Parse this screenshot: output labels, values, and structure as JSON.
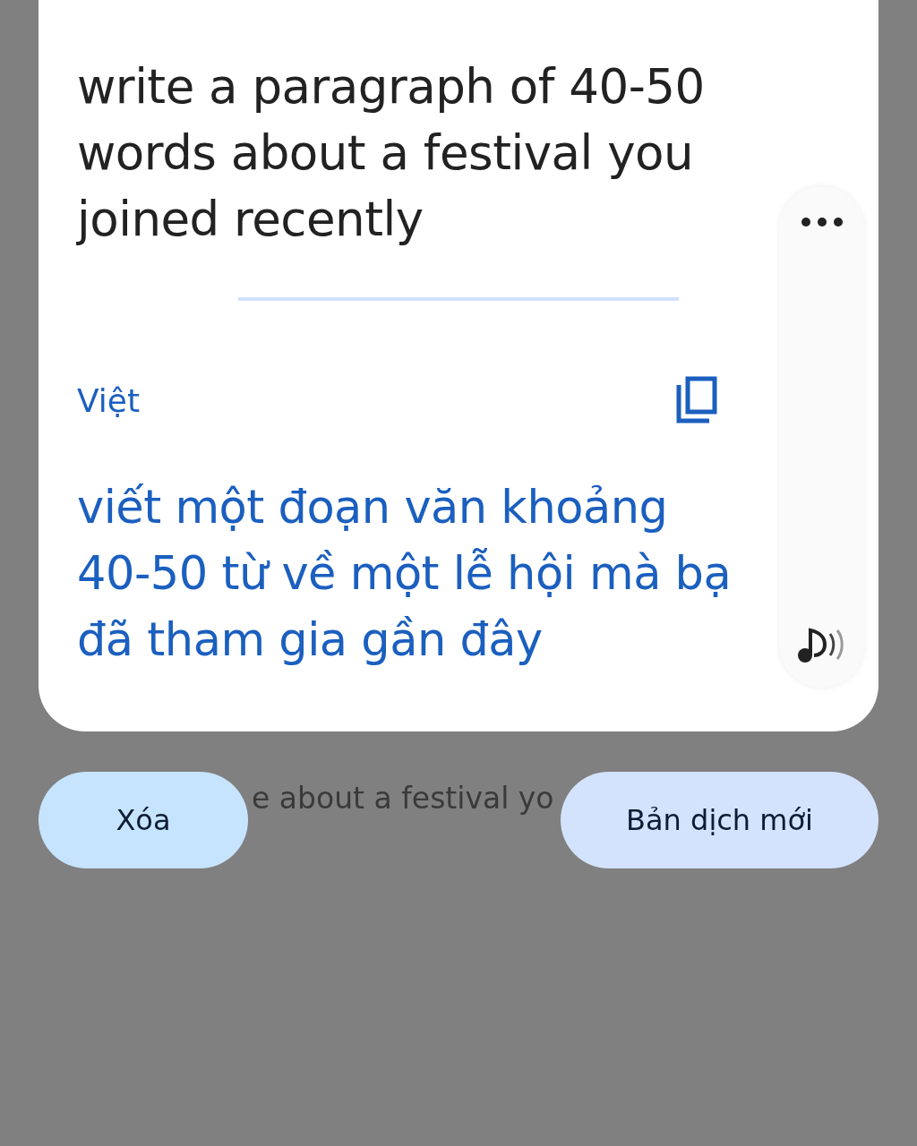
{
  "source": {
    "lines": [
      "write a paragraph of 40-50",
      "words about a festival you",
      "joined recently"
    ]
  },
  "target": {
    "language": "Việt",
    "lines": [
      "viết một đoạn văn khoảng",
      "40-50 từ về một lễ hội mà bạ",
      "đã tham gia gần đây"
    ]
  },
  "background_text": "e about a festival yo",
  "buttons": [
    {
      "label": "Xóa",
      "kind": "clear"
    },
    {
      "label": "Bản dịch mới",
      "kind": "new"
    }
  ]
}
